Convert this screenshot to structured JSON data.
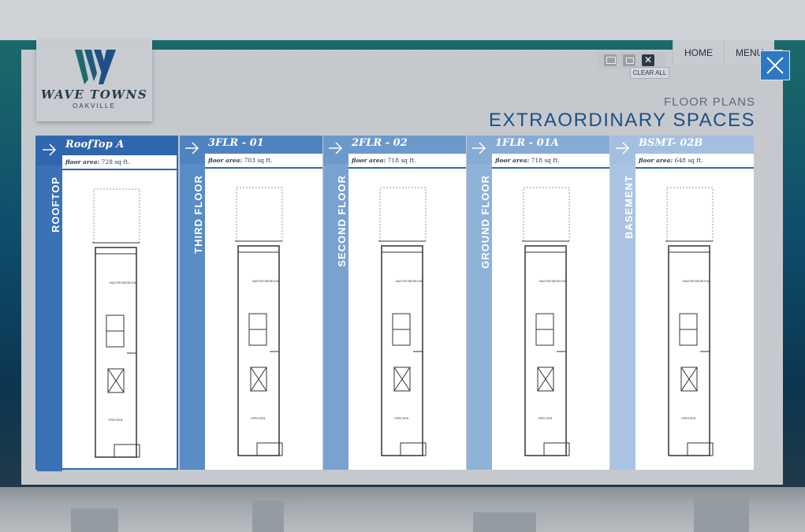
{
  "brand": {
    "name": "WAVE TOWNS",
    "city": "OAKVILLE"
  },
  "nav": {
    "home": "HOME",
    "menu": "MENU"
  },
  "tools": {
    "email_icon": "email-icon",
    "print_icon": "print-icon",
    "clear_icon": "clear-icon",
    "clear_all": "CLEAR ALL"
  },
  "header": {
    "subtitle": "FLOOR PLANS",
    "title": "EXTRAORDINARY SPACES"
  },
  "floor_area_label": "floor area:",
  "plans": [
    {
      "floor": "ROOFTOP",
      "name": "RoofTop A",
      "area": "728 sq ft.",
      "color": "#3a72b6",
      "head": "#2f66ad"
    },
    {
      "floor": "THIRD FLOOR",
      "name": "3FLR - 01",
      "area": "703 sq ft.",
      "color": "#5a8cc6",
      "head": "#4f83c0"
    },
    {
      "floor": "SECOND FLOOR",
      "name": "2FLR - 02",
      "area": "718 sq ft.",
      "color": "#7aa2d0",
      "head": "#6c99cb"
    },
    {
      "floor": "GROUND FLOOR",
      "name": "1FLR - 01A",
      "area": "718 sq ft.",
      "color": "#8fb2d8",
      "head": "#86abd5"
    },
    {
      "floor": "BASEMENT",
      "name": "BSMT- 02B",
      "area": "648 sq ft.",
      "color": "#a9c4e2",
      "head": "#a3c0e0"
    }
  ]
}
